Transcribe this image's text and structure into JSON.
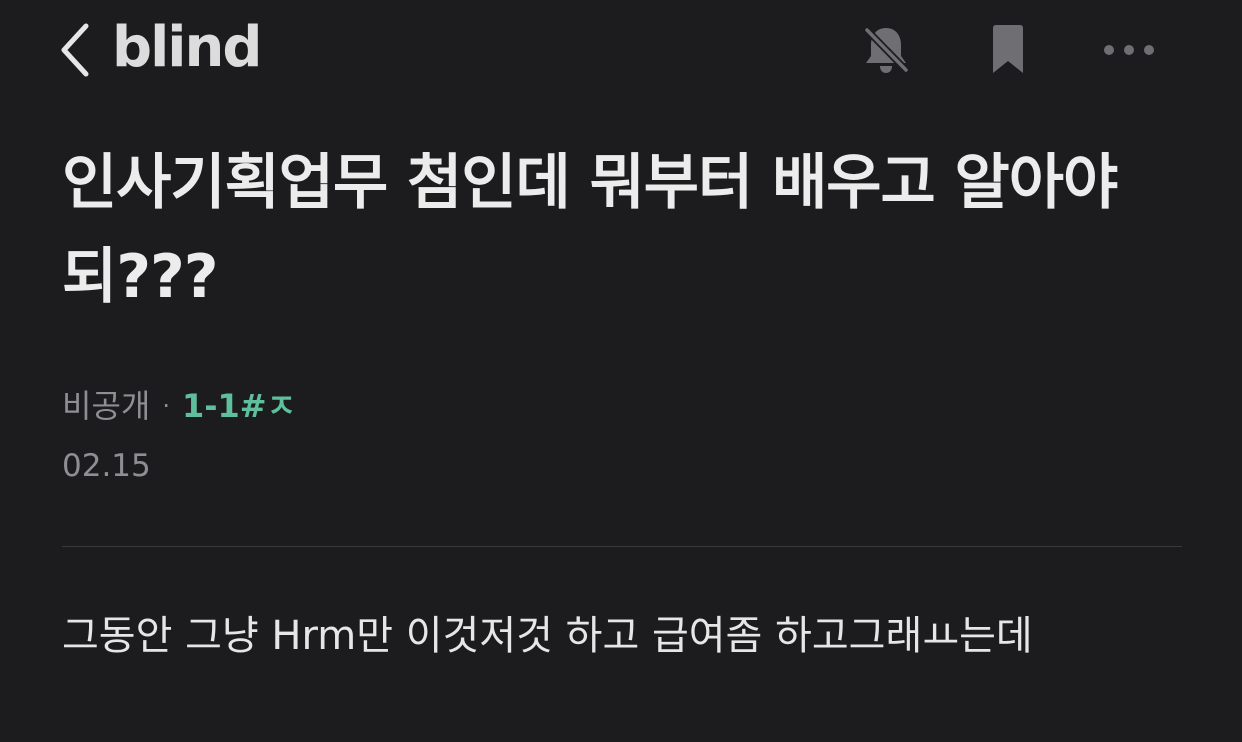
{
  "header": {
    "logo": "blind",
    "icons": {
      "back": "chevron-left-icon",
      "bell": "bell-off-icon",
      "bookmark": "bookmark-icon",
      "more": "more-horizontal-icon"
    }
  },
  "post": {
    "title": "인사기획업무 첨인데 뭐부터 배우고 알아야되???",
    "author": "비공개",
    "separator": "·",
    "tag": "1-1#ㅈ",
    "date": "02.15",
    "body": "그동안 그냥 Hrm만 이것저것 하고 급여좀 하고그래ㅛ는데"
  },
  "colors": {
    "background": "#1c1c1e",
    "accent_tag": "#5fbf9c",
    "muted_text": "#8e8e93",
    "divider": "#3a3a3c"
  }
}
